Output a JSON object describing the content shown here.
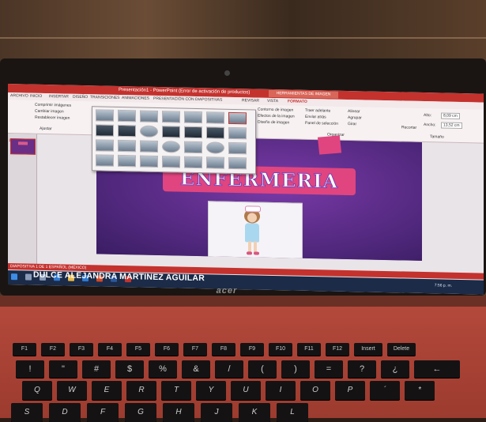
{
  "titlebar": {
    "title": "Presentación1 - PowerPoint (Error de activación de productos)",
    "tools": "HERRAMIENTAS DE IMAGEN"
  },
  "tabs": [
    "ARCHIVO",
    "INICIO",
    "INSERTAR",
    "DISEÑO",
    "TRANSICIONES",
    "ANIMACIONES",
    "PRESENTACIÓN CON DIAPOSITIVAS",
    "REVISAR",
    "VISTA",
    "FORMATO"
  ],
  "ribbon": {
    "ajustar": [
      "Comprimir imágenes",
      "Cambiar imagen",
      "Restablecer imagen"
    ],
    "ajustar_group": "Ajustar",
    "picture_options": [
      "Contorno de imagen",
      "Efectos de la imagen",
      "Diseño de imagen"
    ],
    "arrange": [
      "Traer adelante",
      "Enviar atrás",
      "Panel de selección"
    ],
    "arrange_group": "Organizar",
    "align": [
      "Alinear",
      "Agrupar",
      "Girar"
    ],
    "crop": "Recortar",
    "height": "Alto:",
    "height_value": "8,09 cm",
    "width": "Ancho:",
    "width_value": "13,52 cm",
    "size_group": "Tamaño"
  },
  "thumb_number": "1",
  "slide": {
    "title": "ENFERMERIA",
    "subtitle": "DULCE ALEJANDRA MARTINEZ AGUILAR"
  },
  "status": {
    "left": "DIAPOSITIVA 1 DE 1    ESPAÑOL (MÉXICO)",
    "clock": "7:56 p. m."
  },
  "brand": "acer",
  "keyboard": {
    "fn_row": [
      "F1",
      "F2",
      "F3",
      "F4",
      "F5",
      "F6",
      "F7",
      "F8",
      "F9",
      "F10",
      "F11",
      "F12",
      "Insert",
      "Delete"
    ],
    "num_row": [
      "!",
      "\"",
      "#",
      "$",
      "%",
      "&",
      "/",
      "(",
      ")",
      "=",
      "?",
      "¿",
      "←"
    ],
    "q_row": [
      "Q",
      "W",
      "E",
      "R",
      "T",
      "Y",
      "U",
      "I",
      "O",
      "P",
      "´",
      "*"
    ],
    "a_row": [
      "S",
      "D",
      "F",
      "G",
      "H",
      "J",
      "K",
      "L"
    ]
  }
}
